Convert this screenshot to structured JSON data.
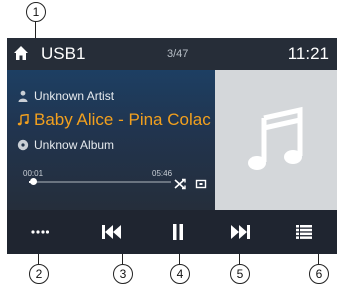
{
  "callouts": [
    "1",
    "2",
    "3",
    "4",
    "5",
    "6"
  ],
  "status_bar": {
    "source": "USB1",
    "track_counter": "3/47",
    "clock": "11:21"
  },
  "now_playing": {
    "artist": "Unknown Artist",
    "title": "Baby Alice - Pina Colac",
    "album": "Unknow Album",
    "time_elapsed": "00:01",
    "time_total": "05:46",
    "progress_fraction": 0.003
  },
  "icons": {
    "home": "home-icon",
    "artist": "person-icon",
    "title": "music-note-icon",
    "album": "disc-icon",
    "shuffle": "shuffle-icon",
    "repeat": "repeat-icon",
    "artwork": "music-note-icon",
    "menu": "more-dots-icon",
    "previous": "skip-previous-icon",
    "pause": "pause-icon",
    "next": "skip-next-icon",
    "list": "list-icon"
  },
  "colors": {
    "accent_title": "#f2a01e",
    "background": "#2c3440",
    "control_bar": "#1f2530",
    "artwork_bg": "#d4d7da"
  }
}
